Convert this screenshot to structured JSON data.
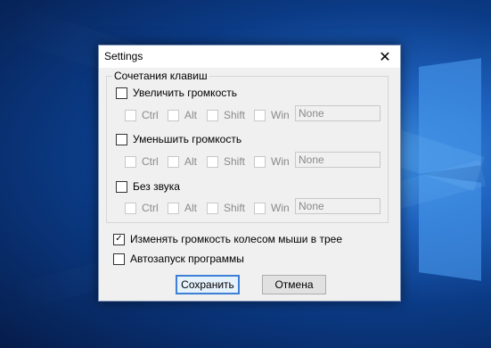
{
  "dialog": {
    "title": "Settings",
    "close_icon": "close-icon",
    "group_title": "Сочетания клавиш",
    "hotkeys": [
      {
        "label": "Увеличить громкость",
        "checked": false,
        "mods": [
          "Ctrl",
          "Alt",
          "Shift",
          "Win"
        ],
        "key": "None"
      },
      {
        "label": "Уменьшить громкость",
        "checked": false,
        "mods": [
          "Ctrl",
          "Alt",
          "Shift",
          "Win"
        ],
        "key": "None"
      },
      {
        "label": "Без звука",
        "checked": false,
        "mods": [
          "Ctrl",
          "Alt",
          "Shift",
          "Win"
        ],
        "key": "None"
      }
    ],
    "wheel_option": {
      "label": "Изменять громкость колесом мыши в трее",
      "checked": true
    },
    "autostart_option": {
      "label": "Автозапуск программы",
      "checked": false
    },
    "save_label": "Сохранить",
    "cancel_label": "Отмена"
  }
}
